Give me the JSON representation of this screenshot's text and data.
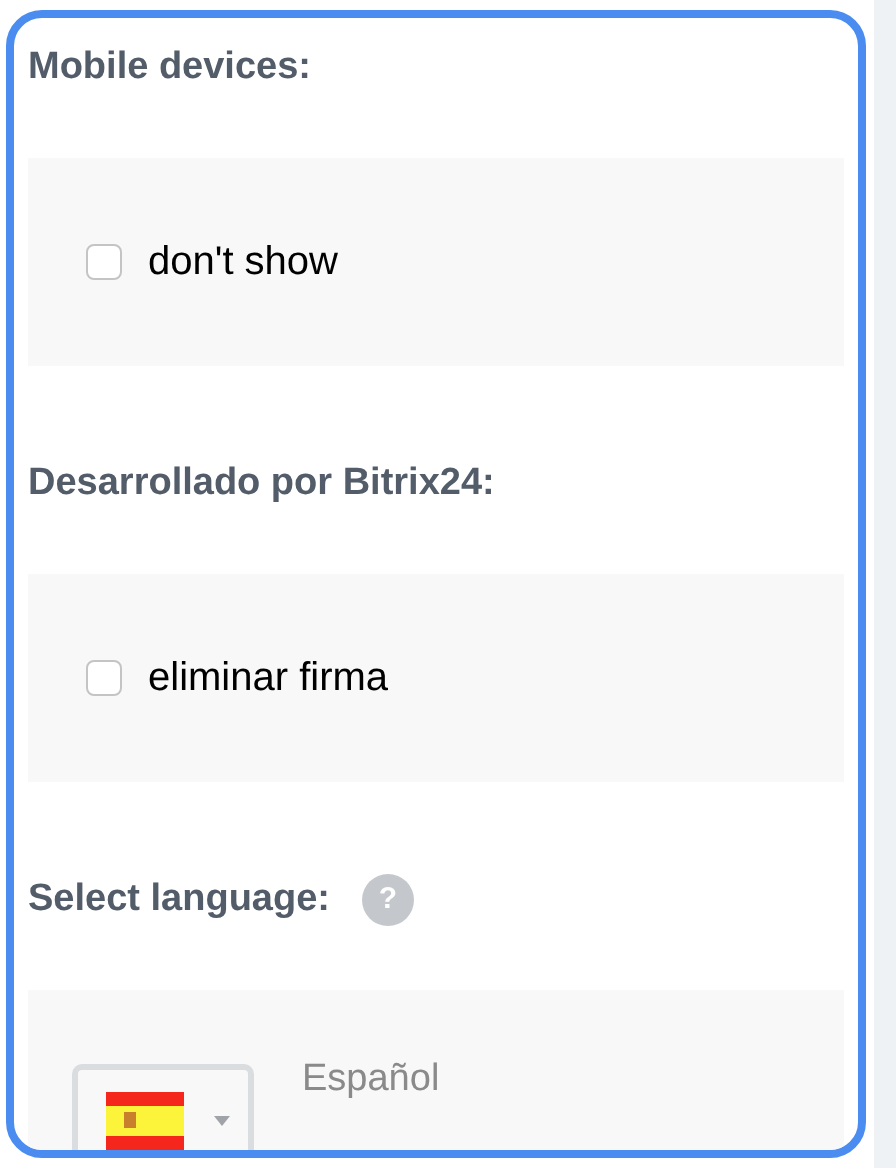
{
  "sections": [
    {
      "kind": "checkbox",
      "heading": "Mobile devices:",
      "label": "don't show",
      "checked": false
    },
    {
      "kind": "checkbox",
      "heading": "Desarrollado por Bitrix24:",
      "label": "eliminar firma",
      "checked": false
    },
    {
      "kind": "language",
      "heading": "Select language:",
      "help": "?",
      "language": "Español"
    }
  ]
}
